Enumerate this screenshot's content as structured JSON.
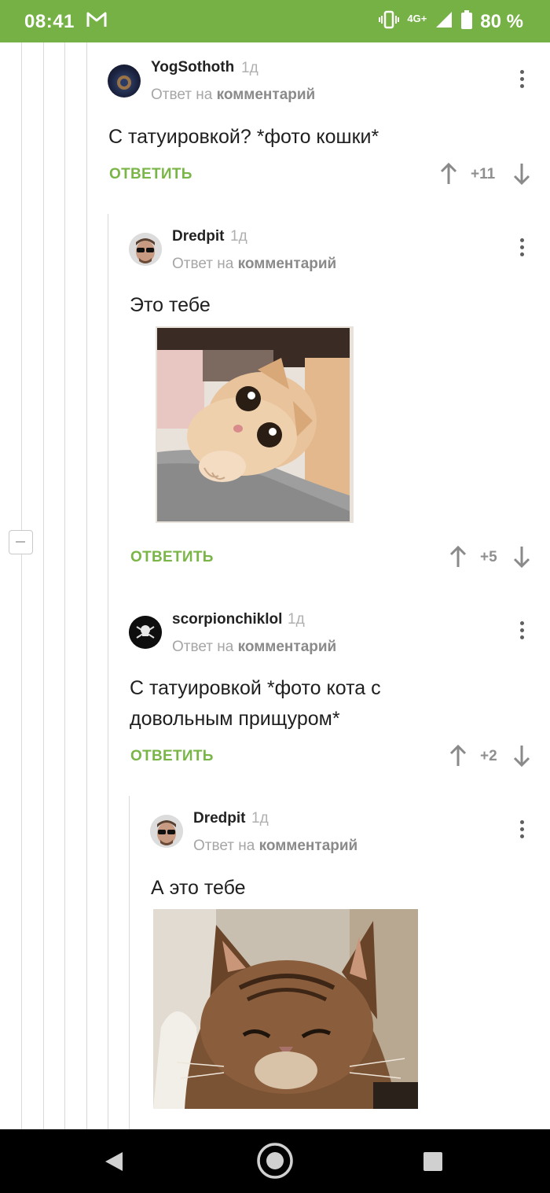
{
  "status_bar": {
    "time": "08:41",
    "network": "4G+",
    "battery": "80 %",
    "icons": [
      "gmail-icon",
      "vibrate-icon",
      "signal-icon",
      "battery-icon"
    ]
  },
  "comments": [
    {
      "author": "YogSothoth",
      "age": "1д",
      "reply_prefix": "Ответ на",
      "reply_target": "комментарий",
      "text_lines": [
        "С татуировкой? *фото кошки*"
      ],
      "reply_label": "ОТВЕТИТЬ",
      "score": "+11"
    },
    {
      "author": "Dredpit",
      "age": "1д",
      "reply_prefix": "Ответ на",
      "reply_target": "комментарий",
      "text_lines": [
        "Это тебе"
      ],
      "image": "kitten-photo",
      "reply_label": "ОТВЕТИТЬ",
      "score": "+5"
    },
    {
      "author": "scorpionchiklol",
      "age": "1д",
      "reply_prefix": "Ответ на",
      "reply_target": "комментарий",
      "text_lines": [
        "С татуировкой *фото кота с",
        "довольным прищуром*"
      ],
      "reply_label": "ОТВЕТИТЬ",
      "score": "+2"
    },
    {
      "author": "Dredpit",
      "age": "1д",
      "reply_prefix": "Ответ на",
      "reply_target": "комментарий",
      "text_lines": [
        "А это тебе"
      ],
      "image": "squinting-cat-photo"
    }
  ],
  "colors": {
    "accent": "#75b144",
    "reply": "#7ab547",
    "thread_line": "#d9d9d9"
  }
}
